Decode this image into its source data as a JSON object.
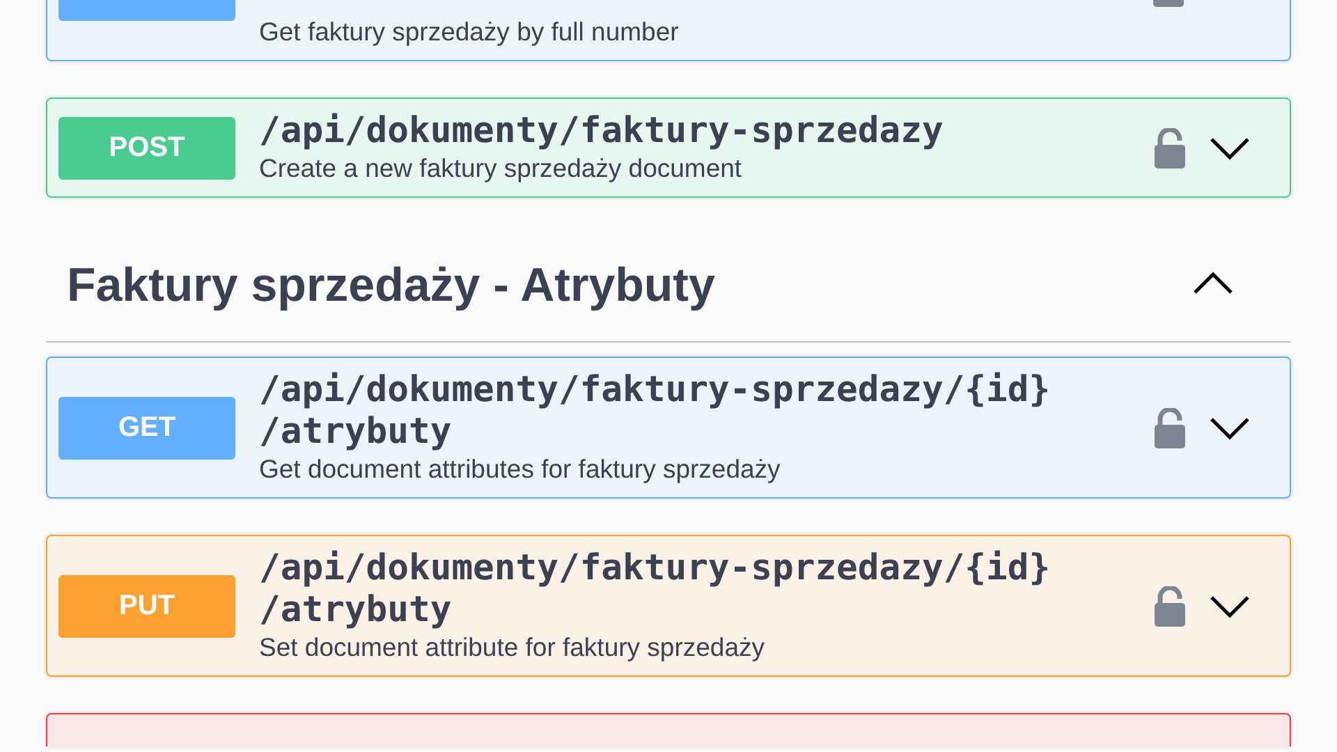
{
  "operations_above": [
    {
      "kind": "get",
      "description": "Get faktury sprzedaży by full number"
    },
    {
      "kind": "post",
      "method": "POST",
      "path": "/api/dokumenty/faktury-sprzedazy",
      "description": "Create a new faktury sprzedaży document",
      "locked": false,
      "expanded": false
    }
  ],
  "section": {
    "title": "Faktury sprzedaży - Atrybuty",
    "expanded": true
  },
  "operations": [
    {
      "kind": "get",
      "method": "GET",
      "path": "/api/dokumenty/faktury-sprzedazy/{id}/atrybuty",
      "description": "Get document attributes for faktury sprzedaży",
      "locked": false,
      "expanded": false
    },
    {
      "kind": "put",
      "method": "PUT",
      "path": "/api/dokumenty/faktury-sprzedazy/{id}/atrybuty",
      "description": "Set document attribute for faktury sprzedaży",
      "locked": false,
      "expanded": false
    },
    {
      "kind": "delete"
    }
  ]
}
